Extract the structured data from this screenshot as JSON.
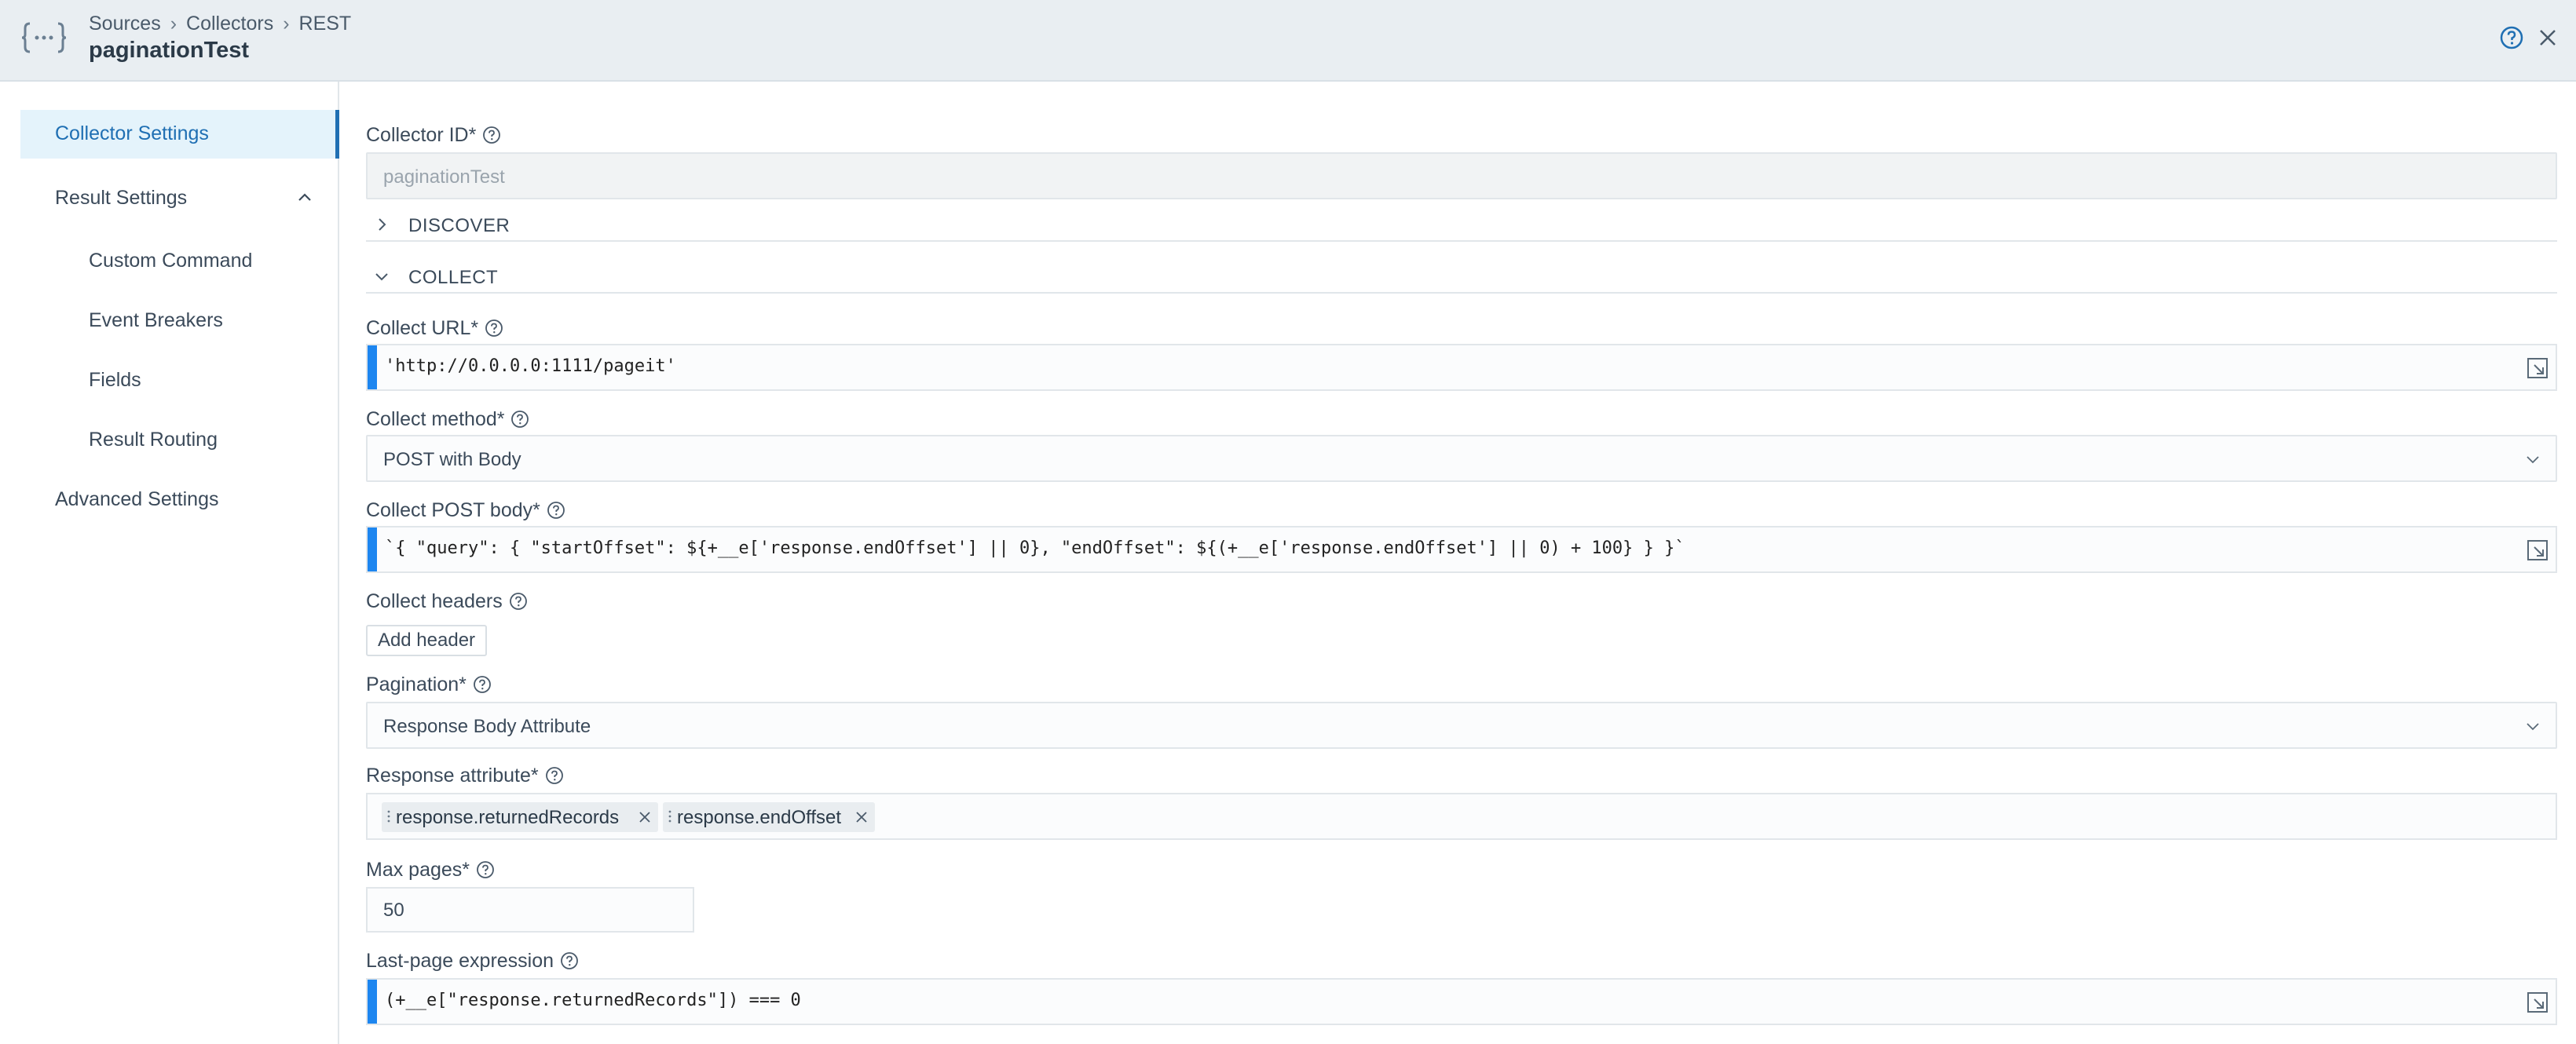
{
  "header": {
    "breadcrumbs": [
      "Sources",
      "Collectors",
      "REST"
    ],
    "separator": "›",
    "title": "paginationTest"
  },
  "sidebar": {
    "items": [
      {
        "label": "Collector Settings",
        "active": true
      },
      {
        "label": "Result Settings",
        "expanded": true
      },
      {
        "label": "Custom Command"
      },
      {
        "label": "Event Breakers"
      },
      {
        "label": "Fields"
      },
      {
        "label": "Result Routing"
      },
      {
        "label": "Advanced Settings"
      }
    ]
  },
  "form": {
    "collector_id": {
      "label": "Collector ID*",
      "placeholder": "paginationTest"
    },
    "discover": {
      "label": "DISCOVER",
      "expanded": false
    },
    "collect": {
      "label": "COLLECT",
      "expanded": true
    },
    "collect_url": {
      "label": "Collect URL*",
      "value": "'http://0.0.0.0:1111/pageit'"
    },
    "collect_method": {
      "label": "Collect method*",
      "value": "POST with Body"
    },
    "collect_post_body": {
      "label": "Collect POST body*",
      "value": "`{ \"query\": { \"startOffset\": ${+__e['response.endOffset'] || 0}, \"endOffset\": ${(+__e['response.endOffset'] || 0) + 100} } }`"
    },
    "collect_headers": {
      "label": "Collect headers",
      "button": "Add header"
    },
    "pagination": {
      "label": "Pagination*",
      "value": "Response Body Attribute"
    },
    "response_attribute": {
      "label": "Response attribute*",
      "tags": [
        "response.returnedRecords",
        "response.endOffset"
      ]
    },
    "max_pages": {
      "label": "Max pages*",
      "value": "50"
    },
    "last_page_expression": {
      "label": "Last-page expression",
      "value": "(+__e[\"response.returnedRecords\"]) === 0"
    }
  },
  "colors": {
    "accent": "#1f6fb3",
    "code_bar": "#1d86f0",
    "string": "#b31412",
    "number": "#098658"
  }
}
